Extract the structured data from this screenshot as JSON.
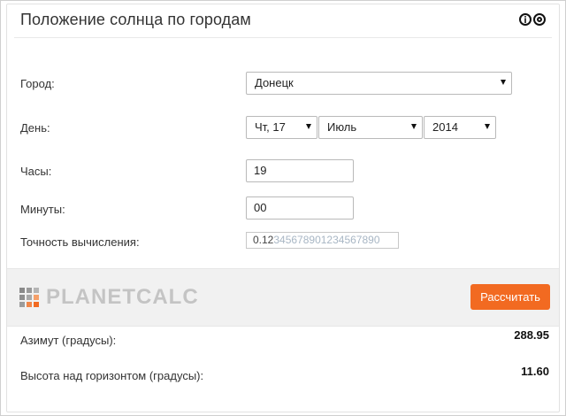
{
  "title": "Положение солнца по городам",
  "icons": [
    "info-icon",
    "target-icon"
  ],
  "form": {
    "city": {
      "label": "Город:",
      "value": "Донецк"
    },
    "day": {
      "label": "День:",
      "day_value": "Чт, 17",
      "month_value": "Июль",
      "year_value": "2014"
    },
    "hours": {
      "label": "Часы:",
      "value": "19"
    },
    "minutes": {
      "label": "Минуты:",
      "value": "00"
    },
    "precision": {
      "label": "Точность вычисления:",
      "value_active": "0.12",
      "value_rest": "345678901234567890"
    }
  },
  "bar": {
    "logo_text": "PLANETCALC",
    "calc_button": "Рассчитать"
  },
  "results": {
    "azimuth": {
      "label": "Азимут (градусы):",
      "value": "288.95"
    },
    "altitude": {
      "label": "Высота над горизонтом (градусы):",
      "value": "11.60"
    }
  },
  "colors": {
    "accent": "#f26a21",
    "logo_gray": "#c4c4c4"
  }
}
